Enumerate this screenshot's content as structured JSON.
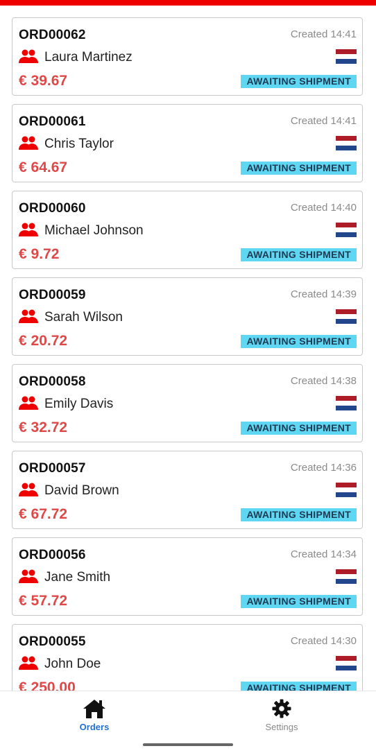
{
  "orders": [
    {
      "id": "ORD00062",
      "created": "Created 14:41",
      "customer": "Laura Martinez",
      "price": "€ 39.67",
      "status": "AWAITING SHIPMENT"
    },
    {
      "id": "ORD00061",
      "created": "Created 14:41",
      "customer": "Chris Taylor",
      "price": "€ 64.67",
      "status": "AWAITING SHIPMENT"
    },
    {
      "id": "ORD00060",
      "created": "Created 14:40",
      "customer": "Michael Johnson",
      "price": "€ 9.72",
      "status": "AWAITING SHIPMENT"
    },
    {
      "id": "ORD00059",
      "created": "Created 14:39",
      "customer": "Sarah Wilson",
      "price": "€ 20.72",
      "status": "AWAITING SHIPMENT"
    },
    {
      "id": "ORD00058",
      "created": "Created 14:38",
      "customer": "Emily Davis",
      "price": "€ 32.72",
      "status": "AWAITING SHIPMENT"
    },
    {
      "id": "ORD00057",
      "created": "Created 14:36",
      "customer": "David Brown",
      "price": "€ 67.72",
      "status": "AWAITING SHIPMENT"
    },
    {
      "id": "ORD00056",
      "created": "Created 14:34",
      "customer": "Jane Smith",
      "price": "€ 57.72",
      "status": "AWAITING SHIPMENT"
    },
    {
      "id": "ORD00055",
      "created": "Created 14:30",
      "customer": "John Doe",
      "price": "€ 250.00",
      "status": "AWAITING SHIPMENT"
    }
  ],
  "icons": {
    "customer": "users-icon",
    "flag": "netherlands-flag-icon"
  },
  "colors": {
    "accent": "#ee0000",
    "price": "#e04848",
    "status_bg": "#5fd6f2",
    "active_tab": "#1f6fd6",
    "inactive_tab": "#888888",
    "flag_red": "#ae1c28",
    "flag_white": "#ffffff",
    "flag_blue": "#21468b"
  },
  "tabbar": {
    "tabs": [
      {
        "label": "Orders",
        "icon": "home-icon",
        "active": true
      },
      {
        "label": "Settings",
        "icon": "gear-icon",
        "active": false
      }
    ]
  }
}
